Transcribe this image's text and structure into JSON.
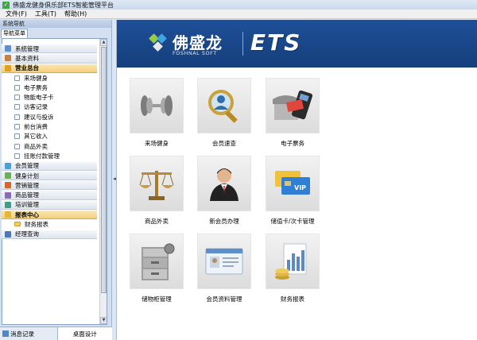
{
  "window": {
    "title": "佛盛龙健身俱乐部ETS智能管理平台"
  },
  "menu": [
    "文件(F)",
    "工具(T)",
    "帮助(H)"
  ],
  "sidebar": {
    "header": "系统导航",
    "tab": "导航菜单",
    "items": [
      {
        "label": "系统管理",
        "type": "group",
        "icon": "system-icon"
      },
      {
        "label": "基本资料",
        "type": "group",
        "icon": "base-info-icon"
      },
      {
        "label": "营业总台",
        "type": "group-open",
        "icon": "front-desk-icon"
      },
      {
        "label": "来场健身",
        "type": "child"
      },
      {
        "label": "电子票务",
        "type": "child"
      },
      {
        "label": "物能电子卡",
        "type": "child"
      },
      {
        "label": "访客记录",
        "type": "child"
      },
      {
        "label": "建议与投诉",
        "type": "child"
      },
      {
        "label": "前台消费",
        "type": "child"
      },
      {
        "label": "其它收入",
        "type": "child"
      },
      {
        "label": "商品外卖",
        "type": "child"
      },
      {
        "label": "挂账付款管理",
        "type": "child"
      },
      {
        "label": "会员管理",
        "type": "group",
        "icon": "member-icon"
      },
      {
        "label": "健身计划",
        "type": "group",
        "icon": "fitness-plan-icon"
      },
      {
        "label": "营销管理",
        "type": "group",
        "icon": "marketing-icon"
      },
      {
        "label": "商品管理",
        "type": "group",
        "icon": "goods-icon"
      },
      {
        "label": "培训管理",
        "type": "group",
        "icon": "training-icon"
      },
      {
        "label": "报表中心",
        "type": "group-open",
        "icon": "report-icon"
      },
      {
        "label": "财务报表",
        "type": "folder"
      },
      {
        "label": "经理查询",
        "type": "group",
        "icon": "manager-icon"
      }
    ],
    "bottom_left": "消息记录",
    "bottom_right": "桌面设计"
  },
  "banner": {
    "brand_cn": "佛盛龙",
    "brand_en": "FOSHNAL SOFT",
    "product": "ETS"
  },
  "tiles": [
    {
      "label": "来场健身",
      "icon": "dumbbell-icon"
    },
    {
      "label": "会员速查",
      "icon": "magnifier-member-icon"
    },
    {
      "label": "电子票务",
      "icon": "card-terminal-icon"
    },
    {
      "label": "商品外卖",
      "icon": "balance-scale-icon"
    },
    {
      "label": "新会员办理",
      "icon": "new-member-icon"
    },
    {
      "label": "储值卡/次卡管理",
      "icon": "vip-card-icon"
    },
    {
      "label": "储物柜管理",
      "icon": "locker-icon"
    },
    {
      "label": "会员资料管理",
      "icon": "member-profile-icon"
    },
    {
      "label": "财务报表",
      "icon": "finance-report-icon"
    }
  ],
  "colors": {
    "banner": "#1e4f98",
    "accent": "#f3cf7c"
  }
}
